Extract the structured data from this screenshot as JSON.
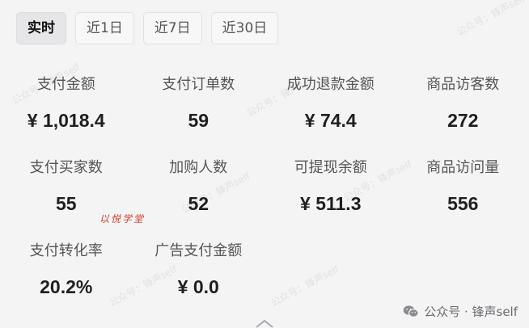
{
  "tabs": [
    {
      "label": "实时",
      "active": true
    },
    {
      "label": "近1日",
      "active": false
    },
    {
      "label": "近7日",
      "active": false
    },
    {
      "label": "近30日",
      "active": false
    }
  ],
  "stats": [
    {
      "label": "支付金额",
      "value": "¥ 1,018.4"
    },
    {
      "label": "支付订单数",
      "value": "59"
    },
    {
      "label": "成功退款金额",
      "value": "¥ 74.4"
    },
    {
      "label": "商品访客数",
      "value": "272"
    },
    {
      "label": "支付买家数",
      "value": "55"
    },
    {
      "label": "加购人数",
      "value": "52"
    },
    {
      "label": "可提现余额",
      "value": "¥ 511.3"
    },
    {
      "label": "商品访问量",
      "value": "556"
    },
    {
      "label": "支付转化率",
      "value": "20.2%"
    },
    {
      "label": "广告支付金额",
      "value": "¥ 0.0"
    }
  ],
  "handwritten_mark": "以悦学堂",
  "watermark_text": "公众号：锋声self",
  "brand": {
    "text": "公众号 · 锋声self",
    "icon": "wechat-icon"
  },
  "colors": {
    "background": "#f4f4f5",
    "active_tab": "#e6e6e8",
    "mark_red": "#d63a2a"
  }
}
